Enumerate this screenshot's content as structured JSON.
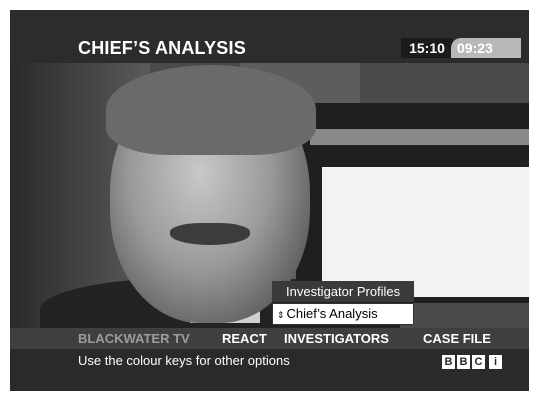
{
  "header": {
    "title": "CHIEF’S ANALYSIS",
    "clock": "15:10",
    "runtime": "09:23"
  },
  "menu": {
    "items": [
      {
        "label": "Investigator Profiles",
        "selected": false
      },
      {
        "label": "Chief’s Analysis",
        "selected": true
      }
    ],
    "scroll_glyph": "⇕"
  },
  "nav": {
    "items": [
      {
        "label": "BLACKWATER TV"
      },
      {
        "label": "REACT"
      },
      {
        "label": "INVESTIGATORS"
      },
      {
        "label": "CASE FILE"
      }
    ]
  },
  "footer": {
    "hint": "Use the colour keys for other options",
    "logo": {
      "letters": [
        "B",
        "B",
        "C"
      ],
      "interactive_glyph": "i"
    }
  }
}
